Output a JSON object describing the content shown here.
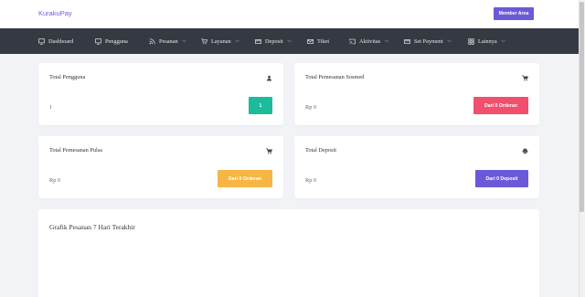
{
  "header": {
    "brand": "KurakuPay",
    "member_button": "Member Area"
  },
  "nav": [
    {
      "label": "Dashboard",
      "icon": "monitor-icon",
      "dropdown": false
    },
    {
      "label": "Pengguna",
      "icon": "monitor-icon",
      "dropdown": false
    },
    {
      "label": "Pesanan",
      "icon": "rss-icon",
      "dropdown": true
    },
    {
      "label": "Layanan",
      "icon": "cart-icon",
      "dropdown": true
    },
    {
      "label": "Deposit",
      "icon": "card-icon",
      "dropdown": true
    },
    {
      "label": "Tiket",
      "icon": "mail-icon",
      "dropdown": false
    },
    {
      "label": "Aktivitas",
      "icon": "cast-icon",
      "dropdown": true
    },
    {
      "label": "Set Payment",
      "icon": "card-icon",
      "dropdown": true
    },
    {
      "label": "Lainnya",
      "icon": "grid-icon",
      "dropdown": true
    }
  ],
  "cards": {
    "total_pengguna": {
      "title": "Total Pengguna",
      "icon": "user-icon",
      "value": "1",
      "button": "1",
      "button_color": "#1abc9c"
    },
    "total_sosmed": {
      "title": "Total Pemesanan Sosmed",
      "icon": "cart-icon",
      "value": "Rp 0",
      "button": "Dari 0 Orderan",
      "button_color": "#f0506e"
    },
    "total_pulsa": {
      "title": "Total Pemesanan Pulsa",
      "icon": "cart-icon",
      "value": "Rp 0",
      "button": "Dari 0 Orderan",
      "button_color": "#f7b543"
    },
    "total_deposit": {
      "title": "Total Deposit",
      "icon": "printer-icon",
      "value": "Rp 0",
      "button": "Dari 0 Deposit",
      "button_color": "#6a5ad9"
    }
  },
  "chart": {
    "title": "Grafik Pesanan 7 Hari Terakhir"
  }
}
